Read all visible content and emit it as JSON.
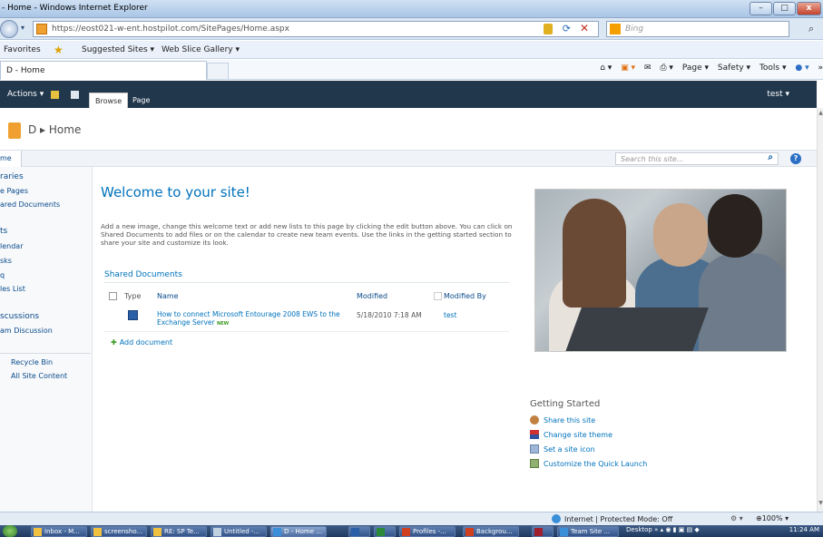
{
  "window": {
    "title": "- Home - Windows Internet Explorer",
    "min": "–",
    "max": "□",
    "close": "x"
  },
  "address": {
    "url": "https://eost021-w-ent.hostpilot.com/SitePages/Home.aspx",
    "search_placeholder": "Bing"
  },
  "favorites": {
    "favorites_label": "Favorites",
    "suggested_sites": "Suggested Sites ▾",
    "web_slice_gallery": "Web Slice Gallery ▾"
  },
  "tab": {
    "title": "D - Home"
  },
  "commandbar": {
    "items": [
      "Page ▾",
      "Safety ▾",
      "Tools ▾"
    ]
  },
  "ribbon": {
    "actions": "Actions ▾",
    "tabs": [
      "Browse",
      "Page"
    ],
    "user": "test ▾"
  },
  "titlearea": {
    "breadcrumb": "D ▸ Home"
  },
  "topnav": {
    "home": "me",
    "search_placeholder": "Search this site...",
    "help": "?"
  },
  "quicklaunch": {
    "items": [
      {
        "label": "raries",
        "head": true
      },
      {
        "label": "e Pages",
        "head": false
      },
      {
        "label": "ared Documents",
        "head": false
      },
      {
        "label": "ts",
        "head": true
      },
      {
        "label": "lendar",
        "head": false
      },
      {
        "label": "sks",
        "head": false
      },
      {
        "label": "q",
        "head": false
      },
      {
        "label": "les List",
        "head": false
      },
      {
        "label": "scussions",
        "head": true
      },
      {
        "label": "am Discussion",
        "head": false
      },
      {
        "label": "Recycle Bin",
        "head": false
      },
      {
        "label": "All Site Content",
        "head": false
      }
    ]
  },
  "main": {
    "title": "Welcome to your site!",
    "intro": "Add a new image, change this welcome text or add new lists to this page by clicking the edit button above. You can click on Shared Documents to add files or on the calendar to create new team events. Use the links in the getting started section to share your site and customize its look."
  },
  "shared_documents": {
    "title": "Shared Documents",
    "columns": [
      "Type",
      "Name",
      "Modified",
      "Modified By"
    ],
    "rows": [
      {
        "name": "How to connect Microsoft Entourage 2008 EWS to the Exchange Server",
        "new_tag": "NEW",
        "modified": "5/18/2010 7:18 AM",
        "modified_by": "test"
      }
    ],
    "add_document": "Add document"
  },
  "getting_started": {
    "title": "Getting Started",
    "items": [
      {
        "label": "Share this site",
        "icon": "share-icon"
      },
      {
        "label": "Change site theme",
        "icon": "theme-icon"
      },
      {
        "label": "Set a site icon",
        "icon": "site-icon-icon"
      },
      {
        "label": "Customize the Quick Launch",
        "icon": "quicklaunch-icon"
      }
    ]
  },
  "statusbar": {
    "zone": "Internet | Protected Mode: Off",
    "zoom": "100%"
  },
  "taskbar": {
    "items": [
      "Inbox - M...",
      "screensho...",
      "RE: SP Te...",
      "Untitled -...",
      "D - Home ...",
      "",
      "",
      "Profiles -...",
      "Backgrou...",
      "",
      "Team Site ..."
    ],
    "tray_label": "Desktop",
    "clock": "11:24 AM"
  },
  "colors": {
    "ribbon_bg": "#21374c",
    "link_blue": "#0072bc",
    "accent_orange": "#f0a030"
  }
}
